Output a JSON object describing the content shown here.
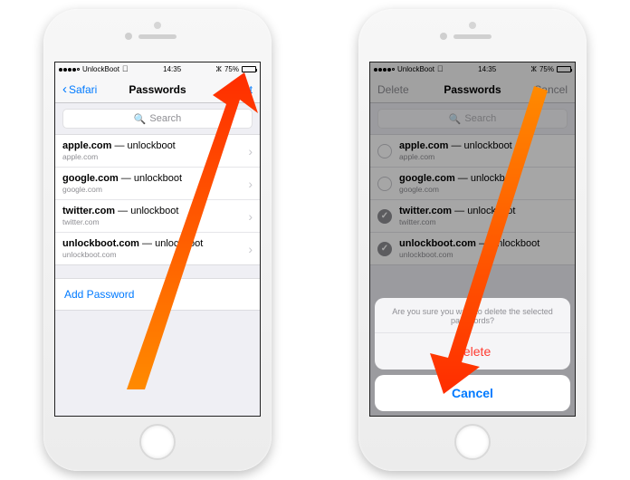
{
  "status": {
    "carrier": "UnlockBoot",
    "wifi_icon": "wifi-icon",
    "time": "14:35",
    "battery_pct": "75%"
  },
  "left": {
    "nav": {
      "back": "Safari",
      "title": "Passwords",
      "edit": "Edit"
    },
    "search_placeholder": "Search",
    "rows": [
      {
        "domain": "apple.com",
        "user": "unlockboot",
        "sub": "apple.com"
      },
      {
        "domain": "google.com",
        "user": "unlockboot",
        "sub": "google.com"
      },
      {
        "domain": "twitter.com",
        "user": "unlockboot",
        "sub": "twitter.com"
      },
      {
        "domain": "unlockboot.com",
        "user": "unlockboot",
        "sub": "unlockboot.com"
      }
    ],
    "add_password": "Add Password"
  },
  "right": {
    "nav": {
      "delete": "Delete",
      "title": "Passwords",
      "cancel": "Cancel"
    },
    "search_placeholder": "Search",
    "rows": [
      {
        "domain": "apple.com",
        "user": "unlockboot",
        "sub": "apple.com",
        "checked": false
      },
      {
        "domain": "google.com",
        "user": "unlockboot",
        "sub": "google.com",
        "checked": false
      },
      {
        "domain": "twitter.com",
        "user": "unlockboot",
        "sub": "twitter.com",
        "checked": true
      },
      {
        "domain": "unlockboot.com",
        "user": "unlockboot",
        "sub": "unlockboot.com",
        "checked": true
      }
    ],
    "sheet": {
      "message": "Are you sure you want to delete the selected passwords?",
      "delete": "Delete",
      "cancel": "Cancel"
    }
  },
  "colors": {
    "tint": "#007aff",
    "destructive": "#ff3b30",
    "secondary": "#8e8e93"
  }
}
